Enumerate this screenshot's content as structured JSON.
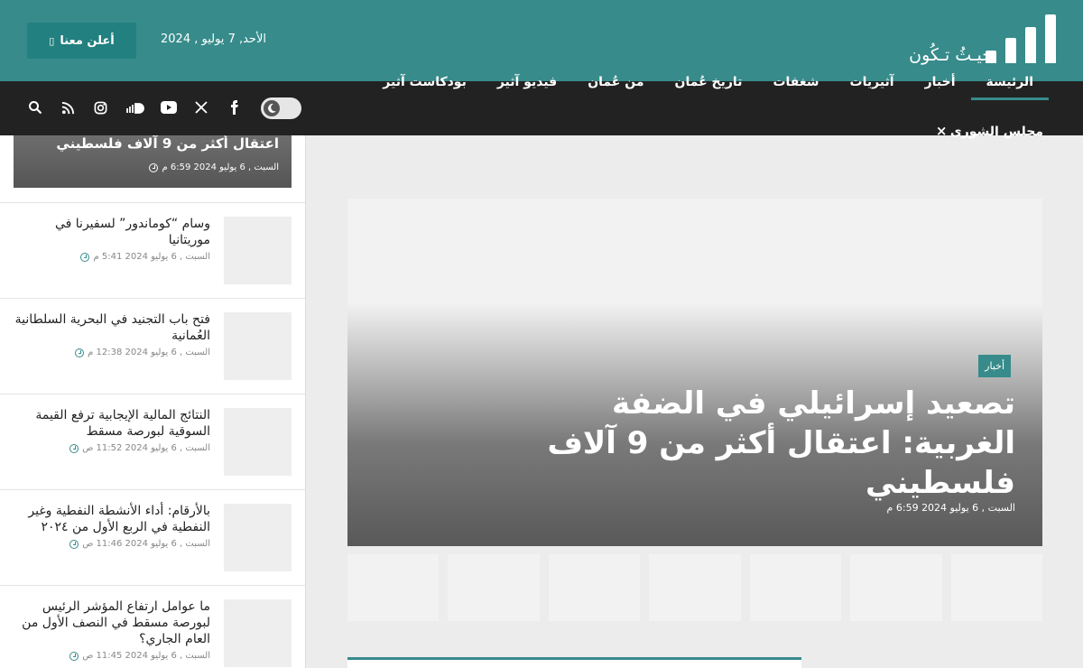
{
  "header": {
    "logo_tagline": "حيـثُ تـكُون",
    "date": "الأحد, 7 يوليو , 2024",
    "advertise_label": "أعلن معنا"
  },
  "nav": {
    "items": [
      {
        "label": "الرئيسة",
        "active": true
      },
      {
        "label": "أخبار"
      },
      {
        "label": "آثيريات"
      },
      {
        "label": "شغفات"
      },
      {
        "label": "تاريخ عُمان"
      },
      {
        "label": "من عُمان"
      },
      {
        "label": "فيديو آثير"
      },
      {
        "label": "بودكاست آثير"
      }
    ],
    "second_row_label": "مجلس الشورى",
    "second_row_close": "×",
    "socials": [
      "search-icon",
      "rss-icon",
      "instagram-icon",
      "soundcloud-icon",
      "youtube-icon",
      "x-icon",
      "facebook-icon"
    ]
  },
  "sidebar": {
    "hero": {
      "title": "اعتقال أكثر من 9 آلاف فلسطيني",
      "date": "السبت , 6 يوليو 2024 6:59 م"
    },
    "items": [
      {
        "title": "وسام “كوماندور” لسفيرنا في موريتانيا",
        "date": "السبت , 6 يوليو 2024 5:41 م"
      },
      {
        "title": "فتح باب التجنيد في البحرية السلطانية العُمانية",
        "date": "السبت , 6 يوليو 2024 12:38 م"
      },
      {
        "title": "النتائج المالية الإيجابية ترفع القيمة السوقية لبورصة مسقط",
        "date": "السبت , 6 يوليو 2024 11:52 ص"
      },
      {
        "title": "بالأرقام: أداء الأنشطة النفطية وغير النفطية في الربع الأول من ٢٠٢٤",
        "date": "السبت , 6 يوليو 2024 11:46 ص"
      },
      {
        "title": "ما عوامل ارتفاع المؤشر الرئيس لبورصة مسقط في النصف الأول من العام الجاري؟",
        "date": "السبت , 6 يوليو 2024 11:45 ص"
      }
    ]
  },
  "main": {
    "hero": {
      "badge": "أخبار",
      "title": "تصعيد إسرائيلي في الضفة الغربية: اعتقال أكثر من 9 آلاف فلسطيني",
      "date": "السبت , 6 يوليو 2024 6:59 م"
    },
    "thumb_count": 7
  },
  "colors": {
    "brand": "#378b8b",
    "nav_bg": "#222222"
  }
}
